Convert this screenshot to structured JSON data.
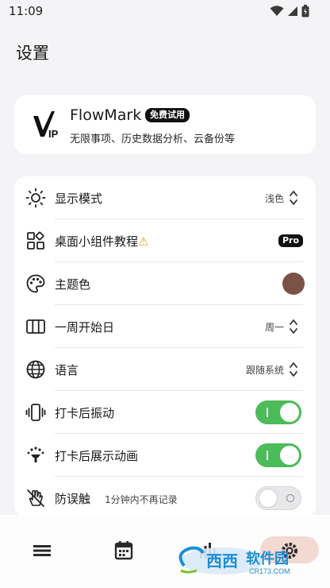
{
  "status_bar": {
    "time": "11:09"
  },
  "page": {
    "title": "设置"
  },
  "vip": {
    "app_name": "FlowMark",
    "badge": "免费试用",
    "description": "无限事项、历史数据分析、云备份等"
  },
  "settings": {
    "display_mode": {
      "label": "显示模式",
      "value": "浅色"
    },
    "widget_tutorial": {
      "label": "桌面小组件教程",
      "warning": "⚠",
      "badge": "Pro"
    },
    "theme_color": {
      "label": "主题色",
      "color": "#7a5246"
    },
    "week_start": {
      "label": "一周开始日",
      "value": "周一"
    },
    "language": {
      "label": "语言",
      "value": "跟随系统"
    },
    "vibrate_after_checkin": {
      "label": "打卡后振动",
      "enabled": true
    },
    "animation_after_checkin": {
      "label": "打卡后展示动画",
      "enabled": true
    },
    "anti_mistouch": {
      "label": "防误触",
      "sub": "1分钟内不再记录",
      "enabled": false
    }
  },
  "colors": {
    "accent_green": "#4cbb5a",
    "active_nav_bg": "#f2d9d2"
  },
  "bottom_nav": {
    "items": [
      {
        "icon": "list-icon"
      },
      {
        "icon": "calendar-icon"
      },
      {
        "icon": "stats-icon"
      },
      {
        "icon": "settings-icon",
        "active": true
      }
    ]
  },
  "watermark": {
    "text": "软件园",
    "sub": "CR173.COM"
  }
}
